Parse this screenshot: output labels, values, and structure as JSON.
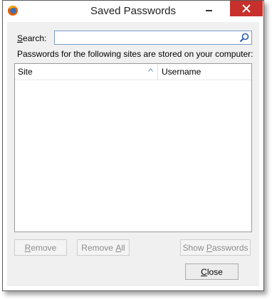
{
  "window": {
    "title": "Saved Passwords"
  },
  "search": {
    "label_u": "S",
    "label_rest": "earch:",
    "value": "",
    "placeholder": ""
  },
  "info_text": "Passwords for the following sites are stored on your computer:",
  "columns": {
    "site": "Site",
    "username": "Username"
  },
  "buttons": {
    "remove_u": "R",
    "remove_rest": "emove",
    "removeall_pre": "Remove ",
    "removeall_u": "A",
    "removeall_rest": "ll",
    "show_pre": "Show ",
    "show_u": "P",
    "show_rest": "asswords",
    "close_u": "C",
    "close_rest": "lose"
  },
  "colors": {
    "close_button_bg": "#c7302b",
    "dialog_bg": "#f0f0f0",
    "search_border": "#7a9ac8"
  },
  "icons": {
    "app": "firefox-icon",
    "search": "magnifier-icon",
    "sort": "sort-ascending-icon"
  }
}
